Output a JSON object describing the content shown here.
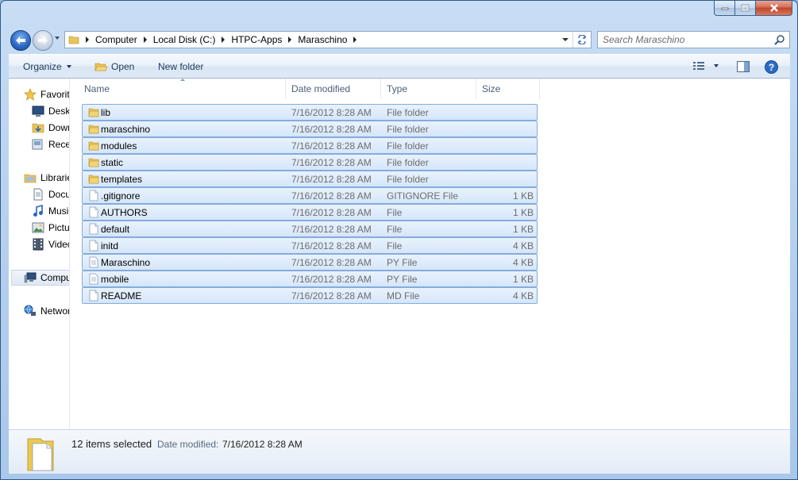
{
  "window": {
    "caption_buttons": [
      "minimize-icon",
      "maximize-icon",
      "close-icon"
    ]
  },
  "address_bar": {
    "breadcrumbs": [
      "Computer",
      "Local Disk (C:)",
      "HTPC-Apps",
      "Maraschino"
    ]
  },
  "search": {
    "placeholder": "Search Maraschino"
  },
  "toolbar": {
    "organize_label": "Organize",
    "open_label": "Open",
    "new_folder_label": "New folder"
  },
  "nav_pane": {
    "items": [
      {
        "label": "Favorites",
        "icon": "star-icon"
      },
      {
        "label": "Desktop",
        "icon": "desktop-icon"
      },
      {
        "label": "Downloads",
        "icon": "downloads-icon"
      },
      {
        "label": "Recent Places",
        "icon": "recent-places-icon"
      },
      {
        "label": "Libraries",
        "icon": "libraries-icon"
      },
      {
        "label": "Documents",
        "icon": "documents-icon"
      },
      {
        "label": "Music",
        "icon": "music-icon"
      },
      {
        "label": "Pictures",
        "icon": "pictures-icon"
      },
      {
        "label": "Videos",
        "icon": "videos-icon"
      },
      {
        "label": "Computer",
        "icon": "computer-icon"
      },
      {
        "label": "Network",
        "icon": "network-icon"
      }
    ]
  },
  "columns": [
    "Name",
    "Date modified",
    "Type",
    "Size"
  ],
  "files": [
    {
      "name": "lib",
      "date": "7/16/2012 8:28 AM",
      "type": "File folder",
      "size": "",
      "icon": "folder-icon"
    },
    {
      "name": "maraschino",
      "date": "7/16/2012 8:28 AM",
      "type": "File folder",
      "size": "",
      "icon": "folder-icon"
    },
    {
      "name": "modules",
      "date": "7/16/2012 8:28 AM",
      "type": "File folder",
      "size": "",
      "icon": "folder-icon"
    },
    {
      "name": "static",
      "date": "7/16/2012 8:28 AM",
      "type": "File folder",
      "size": "",
      "icon": "folder-icon"
    },
    {
      "name": "templates",
      "date": "7/16/2012 8:28 AM",
      "type": "File folder",
      "size": "",
      "icon": "folder-icon"
    },
    {
      "name": ".gitignore",
      "date": "7/16/2012 8:28 AM",
      "type": "GITIGNORE File",
      "size": "1 KB",
      "icon": "file-icon"
    },
    {
      "name": "AUTHORS",
      "date": "7/16/2012 8:28 AM",
      "type": "File",
      "size": "1 KB",
      "icon": "file-icon"
    },
    {
      "name": "default",
      "date": "7/16/2012 8:28 AM",
      "type": "File",
      "size": "1 KB",
      "icon": "file-icon"
    },
    {
      "name": "initd",
      "date": "7/16/2012 8:28 AM",
      "type": "File",
      "size": "4 KB",
      "icon": "file-icon"
    },
    {
      "name": "Maraschino",
      "date": "7/16/2012 8:28 AM",
      "type": "PY File",
      "size": "4 KB",
      "icon": "python-file-icon"
    },
    {
      "name": "mobile",
      "date": "7/16/2012 8:28 AM",
      "type": "PY File",
      "size": "1 KB",
      "icon": "python-file-icon"
    },
    {
      "name": "README",
      "date": "7/16/2012 8:28 AM",
      "type": "MD File",
      "size": "4 KB",
      "icon": "file-icon"
    }
  ],
  "details": {
    "selected_count": "12 items selected",
    "date_label": "Date modified:",
    "date_value": "7/16/2012 8:28 AM"
  },
  "colors": {
    "selection_fill": "#d9e8fb",
    "selection_border": "#84acdd",
    "folder": "#e8c45a"
  }
}
